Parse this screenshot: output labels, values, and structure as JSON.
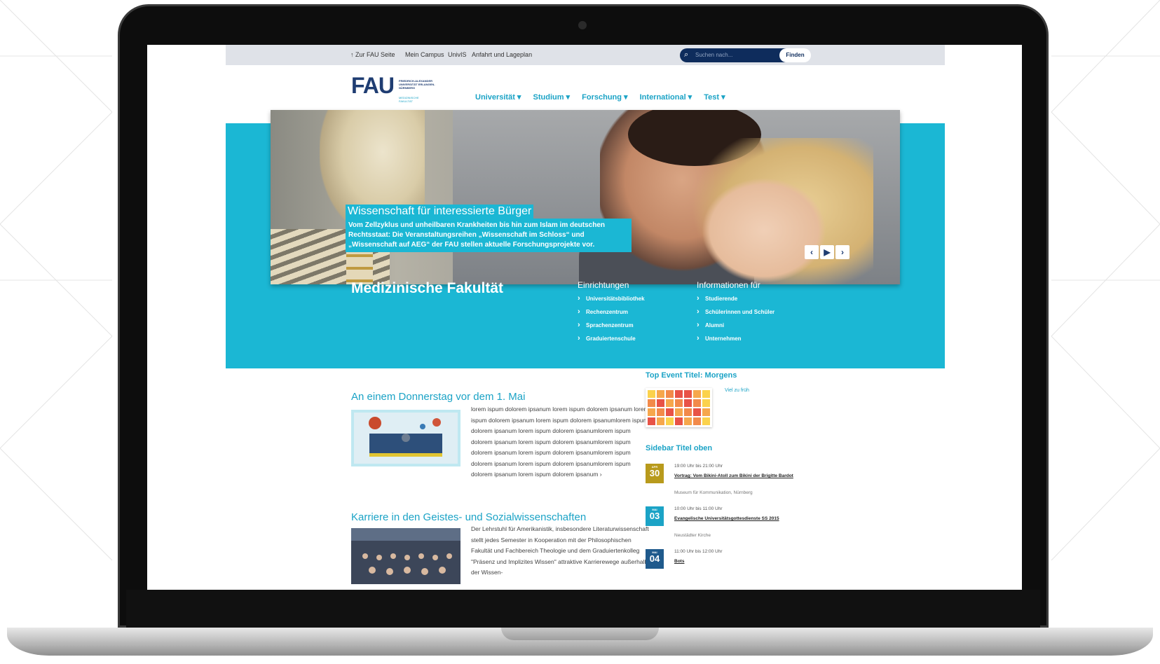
{
  "topbar": {
    "links": [
      "Zur FAU Seite",
      "Mein Campus",
      "UnivIS",
      "Anfahrt und Lageplan"
    ],
    "search_placeholder": "Suchen nach...",
    "search_button": "Finden"
  },
  "logo": {
    "text": "FAU",
    "fullname": "FRIEDRICH-ALEXANDER UNIVERSITÄT ERLANGEN-NÜRNBERG",
    "faculty_short": "MEDIZINISCHE FAKULTÄT"
  },
  "nav": [
    "Universität ▾",
    "Studium ▾",
    "Forschung ▾",
    "International ▾",
    "Test ▾"
  ],
  "hero": {
    "title": "Wissenschaft für interessierte Bürger",
    "text": "Vom Zellzyklus und unheilbaren Krankheiten bis hin zum Islam im deutschen Rechtsstaat: Die Veranstaltungsreihen „Wissenschaft im Schloss“ und „Wissenschaft auf AEG“ der FAU stellen aktuelle Forschungsprojekte vor.",
    "controls": [
      "‹",
      "▶",
      "›"
    ]
  },
  "faculty": "Medizinische Fakultät",
  "einrichtungen": {
    "title": "Einrichtungen",
    "items": [
      "Universitätsbibliothek",
      "Rechenzentrum",
      "Sprachenzentrum",
      "Graduiertenschule"
    ]
  },
  "informationen": {
    "title": "Informationen für",
    "items": [
      "Studierende",
      "Schülerinnen und Schüler",
      "Alumni",
      "Unternehmen"
    ]
  },
  "news": [
    {
      "title": "An einem Donnerstag vor dem 1. Mai",
      "text": "lorem ispum dolorem ipsanum lorem ispum dolorem ipsanum lorem ispum dolorem ipsanum lorem ispum dolorem ipsanumlorem ispum dolorem ipsanum lorem ispum dolorem ipsanumlorem ispum dolorem ipsanum lorem ispum dolorem ipsanumlorem ispum dolorem ipsanum lorem ispum dolorem ipsanumlorem ispum dolorem ipsanum lorem ispum dolorem ipsanumlorem ispum dolorem ipsanum lorem ispum dolorem ipsanum ›"
    },
    {
      "title": "Karriere in den Geistes- und Sozialwissenschaften",
      "text": "Der Lehrstuhl für Amerikanistik, insbesondere Literaturwissenschaft stellt jedes Semester in Kooperation mit der Philosophischen Fakultät und Fachbereich Theologie und dem Graduiertenkolleg \"Präsenz und Implizites Wissen\" attraktive Karrierewege außerhalb der Wissen-"
    }
  ],
  "sidebar": {
    "top_event_title": "Top Event Titel: Morgens",
    "top_event_link": "Viel zu früh",
    "title": "Sidebar Titel oben",
    "events": [
      {
        "month": "APR",
        "day": "30",
        "time": "19:00 Uhr bis 21:00 Uhr",
        "title": "Vortrag: Vom Bikini-Atoll zum Bikini der Brigitte Bardot",
        "place": "Museum für Kommunikation, Nürnberg",
        "color": "#b89a1c"
      },
      {
        "month": "MAI",
        "day": "03",
        "time": "10:00 Uhr bis 11:00 Uhr",
        "title": "Evangelische Universitätsgottesdienste SS 2015",
        "place": "Neustädter Kirche",
        "color": "#1ba3c6"
      },
      {
        "month": "MAI",
        "day": "04",
        "time": "11:00 Uhr bis 12:00 Uhr",
        "title": "Bots",
        "place": "",
        "color": "#1f5a8c"
      }
    ]
  }
}
